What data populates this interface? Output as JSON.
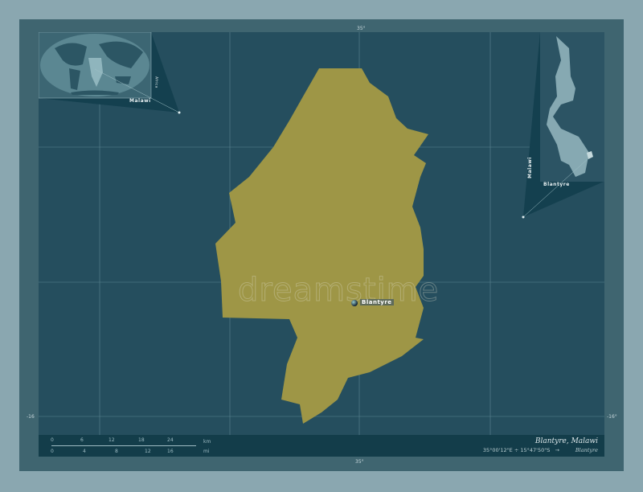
{
  "map": {
    "region_name": "Blantyre",
    "country": "Malawi",
    "city": "Blantyre",
    "colors": {
      "region_fill": "#9e9646",
      "background": "#254e5e",
      "frame": "#3f6570"
    },
    "graticule": {
      "lon_top": [
        "35°"
      ],
      "lon_bottom": [
        "35°"
      ],
      "lat_left": [
        "-16"
      ],
      "lat_right": [
        "-16°"
      ]
    },
    "watermark": "dreamstime"
  },
  "inset_world": {
    "label": "Malawi",
    "continent": "Africa"
  },
  "inset_country": {
    "label_country": "Malawi",
    "label_region": "Blantyre"
  },
  "footer": {
    "title": "Blantyre, Malawi",
    "coordinates": "35°00'12\"E ÷ 15°47'50\"S",
    "arrow": "→",
    "city": "Blantyre",
    "scale": {
      "km_ticks": [
        "0",
        "6",
        "12",
        "18",
        "24"
      ],
      "mi_ticks": [
        "0",
        "4",
        "8",
        "12",
        "16"
      ],
      "km_unit": "km",
      "mi_unit": "mi"
    }
  }
}
